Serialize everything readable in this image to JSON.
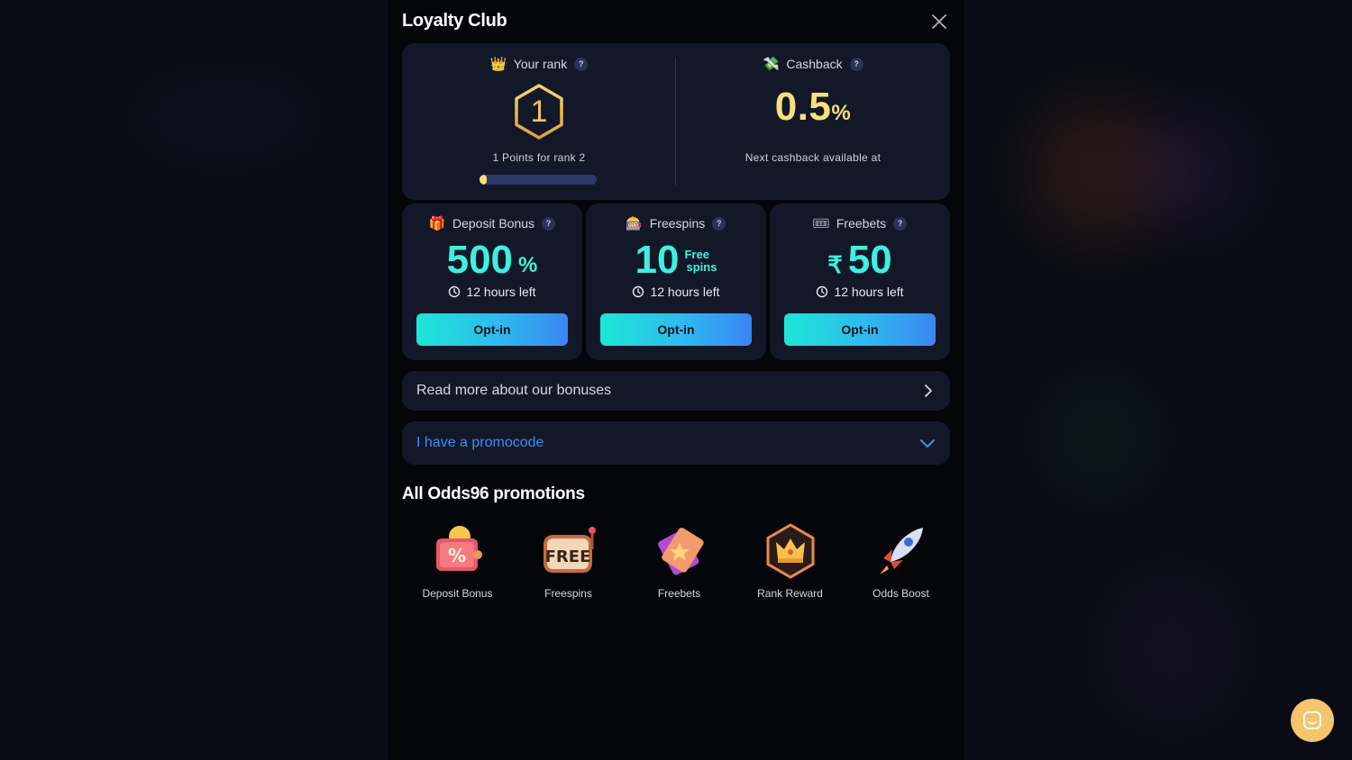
{
  "modal": {
    "title": "Loyalty Club"
  },
  "rank": {
    "label": "Your rank",
    "help": "?",
    "value": "1",
    "points_text": "1 Points for rank 2",
    "progress_fraction": 0.06
  },
  "cashback": {
    "label": "Cashback",
    "help": "?",
    "value": "0.5",
    "unit": "%",
    "next_text": "Next cashback available at"
  },
  "bonuses": [
    {
      "label": "Deposit Bonus",
      "help": "?",
      "value": "500",
      "unit": "%",
      "timer": "12 hours left",
      "button": "Opt-in",
      "icon": "gift-icon"
    },
    {
      "label": "Freespins",
      "help": "?",
      "value": "10",
      "unit_line1": "Free",
      "unit_line2": "spins",
      "timer": "12 hours left",
      "button": "Opt-in",
      "icon": "slot-machine-icon"
    },
    {
      "label": "Freebets",
      "help": "?",
      "currency": "₹",
      "value": "50",
      "timer": "12 hours left",
      "button": "Opt-in",
      "icon": "ticket-icon"
    }
  ],
  "read_more": {
    "label": "Read more about our bonuses"
  },
  "promocode": {
    "label": "I have a promocode"
  },
  "promotions": {
    "title": "All Odds96 promotions",
    "items": [
      {
        "label": "Deposit Bonus",
        "icon": "deposit-bonus-icon"
      },
      {
        "label": "Freespins",
        "icon": "freespins-icon"
      },
      {
        "label": "Freebets",
        "icon": "freebets-icon"
      },
      {
        "label": "Rank Reward",
        "icon": "rank-reward-icon"
      },
      {
        "label": "Odds Boost",
        "icon": "rocket-icon"
      }
    ]
  },
  "colors": {
    "accent_cyan": "#3ff0e0",
    "accent_yellow": "#f7e07a",
    "link_blue": "#3f8ef5",
    "chat": "#f4c56a"
  }
}
